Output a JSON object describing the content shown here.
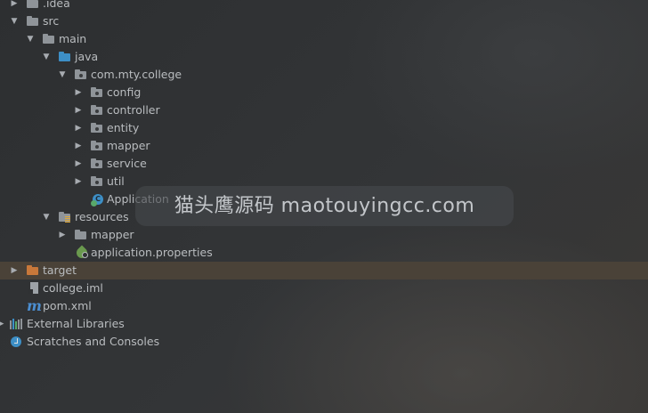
{
  "tree": [
    {
      "label": ".idea",
      "arrow": "right",
      "icon": "folder-gray"
    },
    {
      "label": "src",
      "arrow": "down",
      "icon": "folder-gray"
    },
    {
      "label": "main",
      "arrow": "down",
      "icon": "folder-gray"
    },
    {
      "label": "java",
      "arrow": "down",
      "icon": "folder-blue"
    },
    {
      "label": "com.mty.college",
      "arrow": "down",
      "icon": "package"
    },
    {
      "label": "config",
      "arrow": "right",
      "icon": "package"
    },
    {
      "label": "controller",
      "arrow": "right",
      "icon": "package"
    },
    {
      "label": "entity",
      "arrow": "right",
      "icon": "package"
    },
    {
      "label": "mapper",
      "arrow": "right",
      "icon": "package"
    },
    {
      "label": "service",
      "arrow": "right",
      "icon": "package"
    },
    {
      "label": "util",
      "arrow": "right",
      "icon": "package"
    },
    {
      "label": "Application",
      "arrow": "none",
      "icon": "spring-class"
    },
    {
      "label": "resources",
      "arrow": "down",
      "icon": "resources-folder"
    },
    {
      "label": "mapper",
      "arrow": "right",
      "icon": "folder-gray"
    },
    {
      "label": "application.properties",
      "arrow": "none",
      "icon": "spring-properties"
    },
    {
      "label": "target",
      "arrow": "right",
      "icon": "folder-orange"
    },
    {
      "label": "college.iml",
      "arrow": "none",
      "icon": "iml-file"
    },
    {
      "label": "pom.xml",
      "arrow": "none",
      "icon": "maven-file"
    },
    {
      "label": "External Libraries",
      "arrow": "right",
      "icon": "libraries"
    },
    {
      "label": "Scratches and Consoles",
      "arrow": "none",
      "icon": "scratches"
    }
  ],
  "watermark": "猫头鹰源码 maotouyingcc.com",
  "colors": {
    "background": "#2f3133",
    "text": "#b9bcbf",
    "highlight_row": "#4a4238",
    "folder_gray": "#8f9499",
    "folder_blue": "#3d8fc6",
    "folder_orange": "#c8783a"
  }
}
